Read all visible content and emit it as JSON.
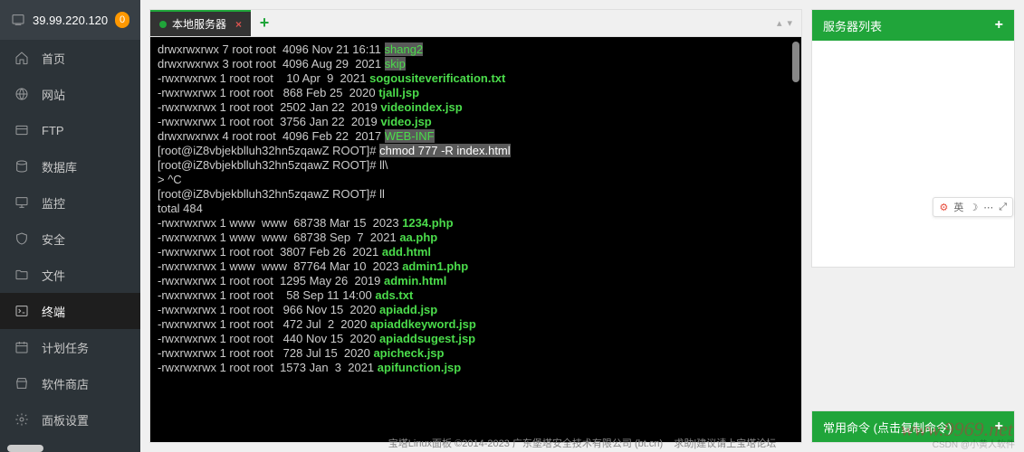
{
  "sidebar": {
    "ip": "39.99.220.120",
    "badge": "0",
    "items": [
      {
        "label": "首页",
        "icon": "home"
      },
      {
        "label": "网站",
        "icon": "globe"
      },
      {
        "label": "FTP",
        "icon": "ftp"
      },
      {
        "label": "数据库",
        "icon": "db"
      },
      {
        "label": "监控",
        "icon": "monitor"
      },
      {
        "label": "安全",
        "icon": "shield"
      },
      {
        "label": "文件",
        "icon": "folder"
      },
      {
        "label": "终端",
        "icon": "terminal",
        "active": true
      },
      {
        "label": "计划任务",
        "icon": "calendar"
      },
      {
        "label": "软件商店",
        "icon": "store"
      },
      {
        "label": "面板设置",
        "icon": "gear"
      }
    ]
  },
  "tabs": {
    "active": "本地服务器"
  },
  "terminal": {
    "prompt": "[root@iZ8vbjekblluh32hn5zqawZ ROOT]#",
    "lines": [
      {
        "perm": "drwxrwxrwx 7 root root  4096 Nov 21 16:11 ",
        "name": "shang2",
        "hl": true
      },
      {
        "perm": "drwxrwxrwx 3 root root  4096 Aug 29  2021 ",
        "name": "skip",
        "hl": true
      },
      {
        "perm": "-rwxrwxrwx 1 root root    10 Apr  9  2021 ",
        "name": "sogousiteverification.txt"
      },
      {
        "perm": "-rwxrwxrwx 1 root root   868 Feb 25  2020 ",
        "name": "tjall.jsp"
      },
      {
        "perm": "-rwxrwxrwx 1 root root  2502 Jan 22  2019 ",
        "name": "videoindex.jsp"
      },
      {
        "perm": "-rwxrwxrwx 1 root root  3756 Jan 22  2019 ",
        "name": "video.jsp"
      },
      {
        "perm": "drwxrwxrwx 4 root root  4096 Feb 22  2017 ",
        "name": "WEB-INF",
        "hl": true
      }
    ],
    "cmd1": "chmod 777 -R index.html",
    "cmd2": "ll\\",
    "interrupt": "> ^C",
    "cmd3": "ll",
    "total": "total 484",
    "lines2": [
      {
        "perm": "-rwxrwxrwx 1 www  www  68738 Mar 15  2023 ",
        "name": "1234.php"
      },
      {
        "perm": "-rwxrwxrwx 1 www  www  68738 Sep  7  2021 ",
        "name": "aa.php"
      },
      {
        "perm": "-rwxrwxrwx 1 root root  3807 Feb 26  2021 ",
        "name": "add.html"
      },
      {
        "perm": "-rwxrwxrwx 1 www  www  87764 Mar 10  2023 ",
        "name": "admin1.php"
      },
      {
        "perm": "-rwxrwxrwx 1 root root  1295 May 26  2019 ",
        "name": "admin.html"
      },
      {
        "perm": "-rwxrwxrwx 1 root root    58 Sep 11 14:00 ",
        "name": "ads.txt"
      },
      {
        "perm": "-rwxrwxrwx 1 root root   966 Nov 15  2020 ",
        "name": "apiadd.jsp"
      },
      {
        "perm": "-rwxrwxrwx 1 root root   472 Jul  2  2020 ",
        "name": "apiaddkeyword.jsp"
      },
      {
        "perm": "-rwxrwxrwx 1 root root   440 Nov 15  2020 ",
        "name": "apiaddsugest.jsp"
      },
      {
        "perm": "-rwxrwxrwx 1 root root   728 Jul 15  2020 ",
        "name": "apicheck.jsp"
      },
      {
        "perm": "-rwxrwxrwx 1 root root  1573 Jan  3  2021 ",
        "name": "apifunction.jsp"
      }
    ]
  },
  "right": {
    "servers_title": "服务器列表",
    "commands_title": "常用命令 (点击复制命令)"
  },
  "ime": {
    "text": "英"
  },
  "footer": "宝塔Linux面板 ©2014-2023 广东堡塔安全技术有限公司 (bt.cn)",
  "help": "求助|建议请上宝塔论坛",
  "watermark": "www.9969.net",
  "watermark2": "CSDN @小黄人软件"
}
